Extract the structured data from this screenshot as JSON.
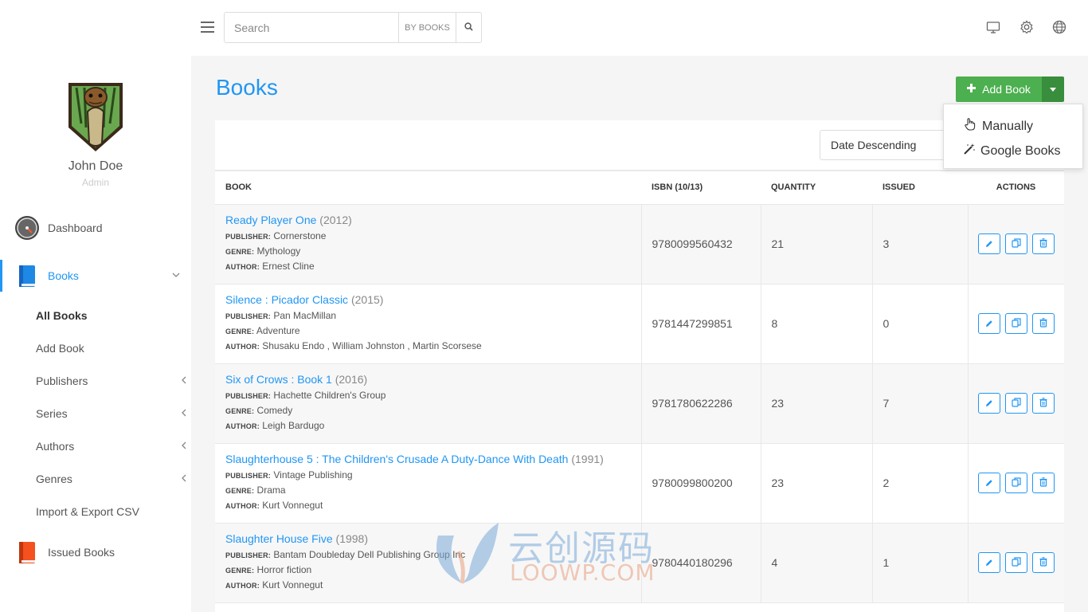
{
  "user": {
    "name": "John Doe",
    "role": "Admin"
  },
  "nav": {
    "dashboard": "Dashboard",
    "books": "Books",
    "sub": [
      "All Books",
      "Add Book",
      "Publishers",
      "Series",
      "Authors",
      "Genres",
      "Import & Export CSV"
    ],
    "issued": "Issued Books"
  },
  "search": {
    "placeholder": "Search",
    "scope": "BY BOOKS"
  },
  "page": {
    "title": "Books"
  },
  "add_book": {
    "label": "Add Book",
    "menu": [
      "Manually",
      "Google Books"
    ]
  },
  "sort": {
    "selected": "Date Descending"
  },
  "table": {
    "headers": [
      "BOOK",
      "ISBN (10/13)",
      "QUANTITY",
      "ISSUED",
      "ACTIONS"
    ],
    "field_labels": {
      "publisher": "PUBLISHER:",
      "genre": "GENRE:",
      "author": "AUTHOR:"
    },
    "rows": [
      {
        "title": "Ready Player One",
        "year": "(2012)",
        "publisher": "Cornerstone",
        "genre": "Mythology",
        "author": "Ernest Cline",
        "isbn": "9780099560432",
        "quantity": "21",
        "issued": "3"
      },
      {
        "title": "Silence : Picador Classic",
        "year": "(2015)",
        "publisher": "Pan MacMillan",
        "genre": "Adventure",
        "author": "Shusaku Endo , William Johnston , Martin Scorsese",
        "isbn": "9781447299851",
        "quantity": "8",
        "issued": "0"
      },
      {
        "title": "Six of Crows : Book 1",
        "year": "(2016)",
        "publisher": "Hachette Children's Group",
        "genre": "Comedy",
        "author": "Leigh Bardugo",
        "isbn": "9781780622286",
        "quantity": "23",
        "issued": "7"
      },
      {
        "title": "Slaughterhouse 5 : The Children's Crusade A Duty-Dance With Death",
        "year": "(1991)",
        "publisher": "Vintage Publishing",
        "genre": "Drama",
        "author": "Kurt Vonnegut",
        "isbn": "9780099800200",
        "quantity": "23",
        "issued": "2"
      },
      {
        "title": "Slaughter House Five",
        "year": "(1998)",
        "publisher": "Bantam Doubleday Dell Publishing Group Inc",
        "genre": "Horror fiction",
        "author": "Kurt Vonnegut",
        "isbn": "9780440180296",
        "quantity": "4",
        "issued": "1"
      }
    ]
  },
  "watermark": {
    "cn": "云创源码",
    "en": "LOOWP.COM"
  },
  "colors": {
    "accent": "#2196f3",
    "success": "#4caf50",
    "success_dark": "#388e3c"
  }
}
